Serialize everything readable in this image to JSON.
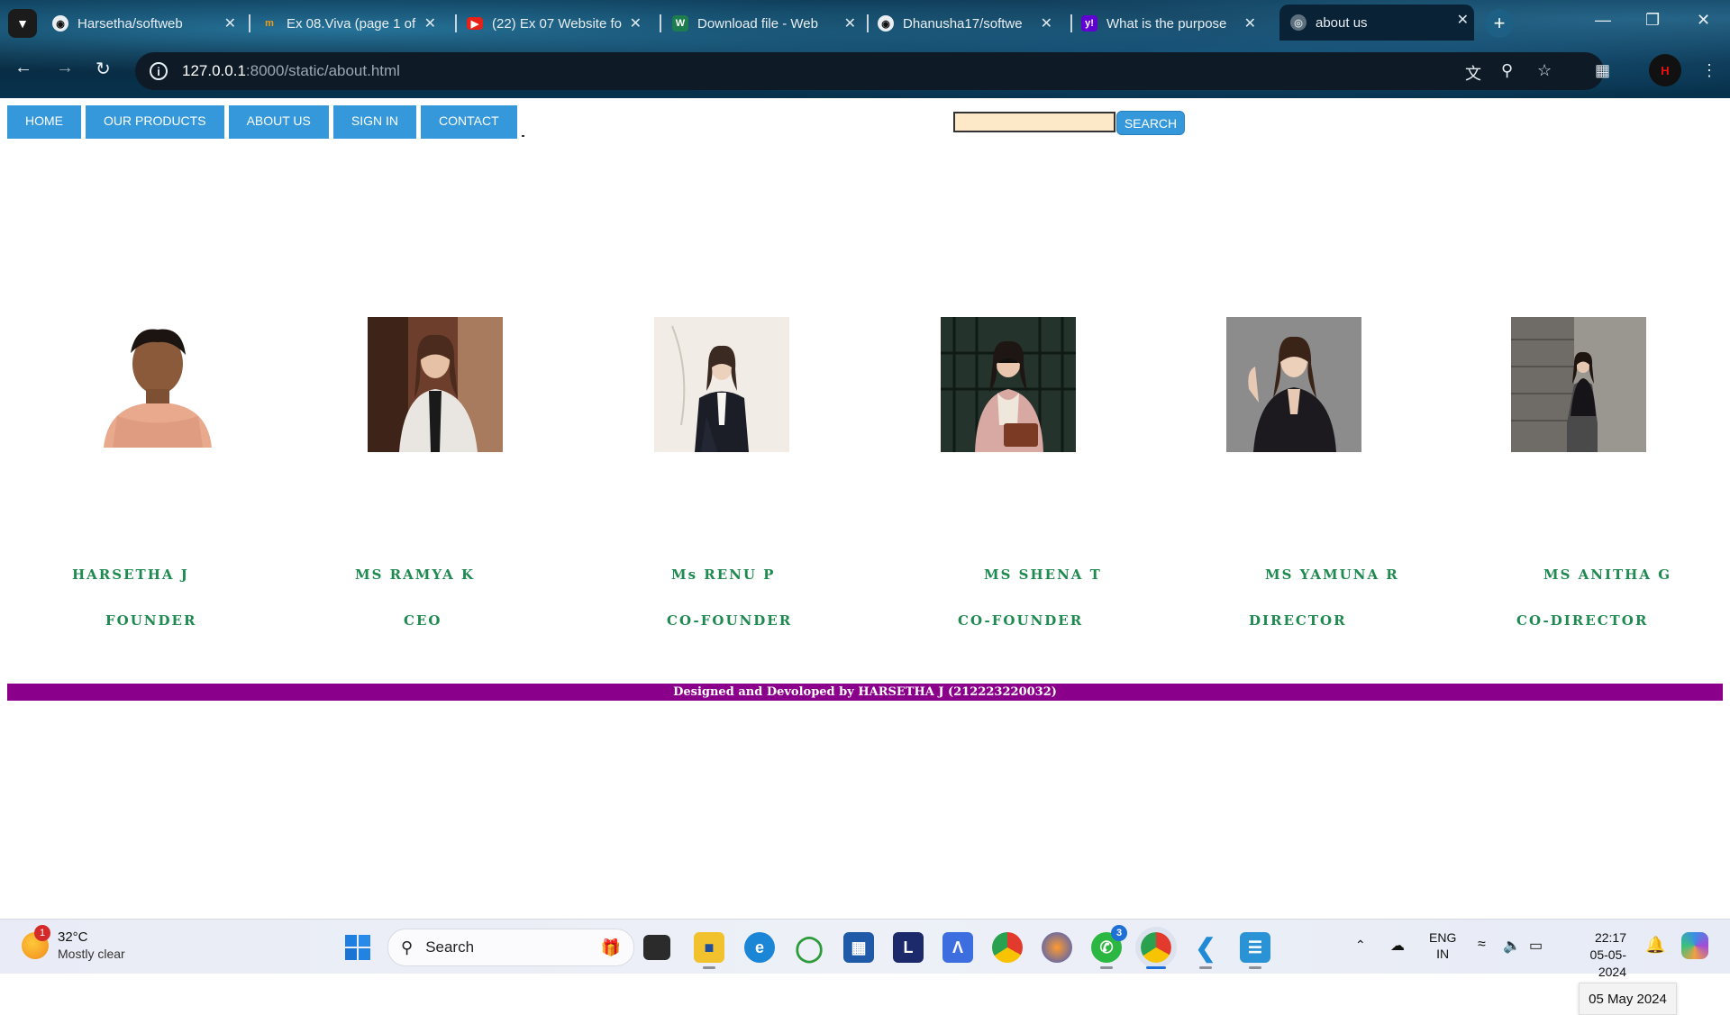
{
  "browser": {
    "tabs": [
      {
        "title": "Harsetha/softweb",
        "favicon": "github-icon"
      },
      {
        "title": "Ex 08.Viva (page 1 of",
        "favicon": "moodle-icon"
      },
      {
        "title": "(22) Ex 07 Website fo",
        "favicon": "youtube-icon"
      },
      {
        "title": "Download file - Web",
        "favicon": "w-icon"
      },
      {
        "title": "Dhanusha17/softwe",
        "favicon": "github-icon"
      },
      {
        "title": "What is the purpose",
        "favicon": "yahoo-icon"
      },
      {
        "title": "about us",
        "favicon": "globe-icon",
        "active": true
      }
    ],
    "new_tab_label": "+",
    "address": {
      "host": "127.0.0.1",
      "rest": ":8000/static/about.html"
    },
    "profile_label": "H"
  },
  "nav": {
    "items": [
      "HOME",
      "OUR PRODUCTS",
      "ABOUT US",
      "SIGN IN",
      "CONTACT"
    ],
    "search_value": "",
    "search_button": "SEARCH"
  },
  "team": [
    {
      "name": "HARSETHA J",
      "role": "FOUNDER"
    },
    {
      "name": "MS RAMYA K",
      "role": "CEO"
    },
    {
      "name": "Ms RENU P",
      "role": "CO-FOUNDER"
    },
    {
      "name": "MS SHENA T",
      "role": "CO-FOUNDER"
    },
    {
      "name": "MS YAMUNA R",
      "role": "DIRECTOR"
    },
    {
      "name": "MS ANITHA G",
      "role": "CO-DIRECTOR"
    }
  ],
  "footer": {
    "text": "Designed and Devoloped by HARSETHA J (212223220032)"
  },
  "tooltip": {
    "date": "05 May 2024"
  },
  "taskbar": {
    "weather_temp": "32°C",
    "weather_desc": "Mostly clear",
    "weather_badge": "1",
    "search_label": "Search",
    "whatsapp_badge": "3",
    "lang_top": "ENG",
    "lang_bottom": "IN",
    "time": "22:17",
    "date": "05-05-2024"
  },
  "colors": {
    "nav_blue": "#3498db",
    "name_green": "#1e8a50",
    "footer_purple": "#8b008b",
    "search_bg": "#fde8c8"
  }
}
